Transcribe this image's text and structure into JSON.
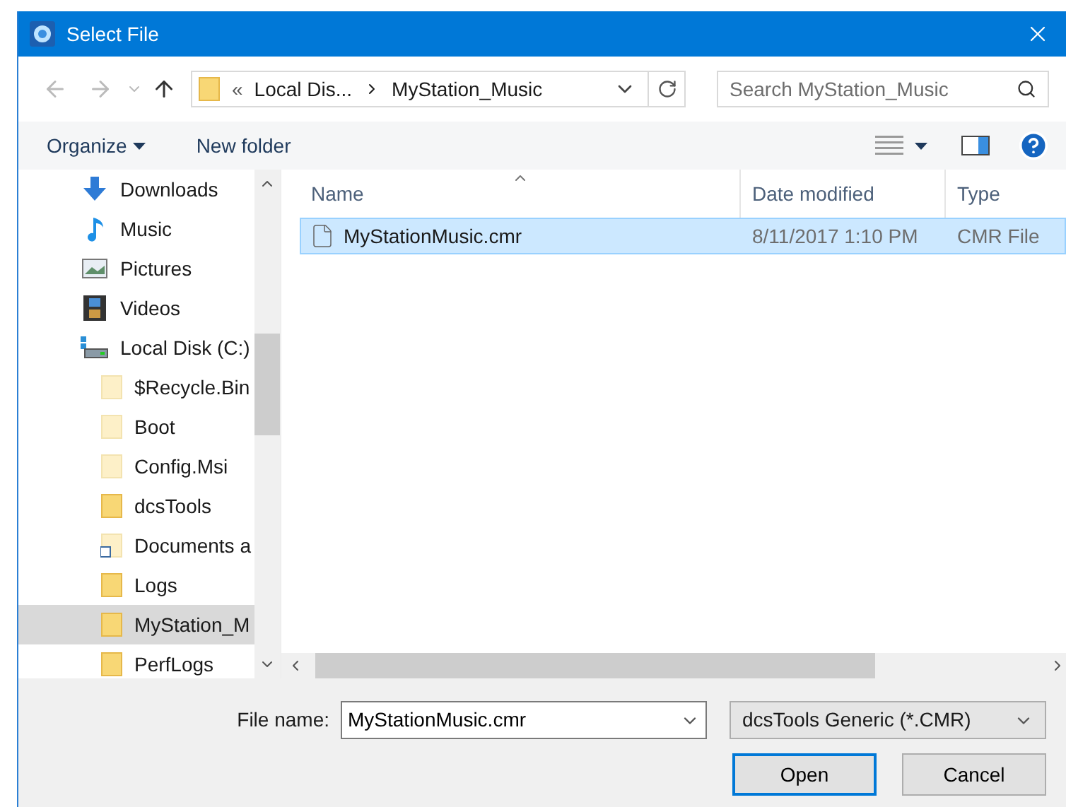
{
  "window": {
    "title": "Select File"
  },
  "address": {
    "overflow": "«",
    "crumbs": [
      "Local Dis...",
      "MyStation_Music"
    ]
  },
  "search": {
    "placeholder": "Search MyStation_Music"
  },
  "toolbar": {
    "organize": "Organize",
    "new_folder": "New folder"
  },
  "sidebar": {
    "items": [
      {
        "kind": "downloads",
        "label": "Downloads",
        "selected": false
      },
      {
        "kind": "music",
        "label": "Music",
        "selected": false
      },
      {
        "kind": "pictures",
        "label": "Pictures",
        "selected": false
      },
      {
        "kind": "videos",
        "label": "Videos",
        "selected": false
      },
      {
        "kind": "drive",
        "label": "Local Disk (C:)",
        "selected": false,
        "children": [
          {
            "kind": "folder",
            "label": "$Recycle.Bin",
            "hidden": true,
            "selected": false
          },
          {
            "kind": "folder",
            "label": "Boot",
            "hidden": true,
            "selected": false
          },
          {
            "kind": "folder",
            "label": "Config.Msi",
            "hidden": true,
            "selected": false
          },
          {
            "kind": "folder",
            "label": "dcsTools",
            "hidden": false,
            "selected": false
          },
          {
            "kind": "shortcut",
            "label": "Documents a",
            "hidden": true,
            "selected": false
          },
          {
            "kind": "folder",
            "label": "Logs",
            "hidden": false,
            "selected": false
          },
          {
            "kind": "folder",
            "label": "MyStation_M",
            "hidden": false,
            "selected": true
          },
          {
            "kind": "folder",
            "label": "PerfLogs",
            "hidden": false,
            "selected": false
          }
        ]
      }
    ]
  },
  "table": {
    "columns": [
      "Name",
      "Date modified",
      "Type"
    ],
    "rows": [
      {
        "name": "MyStationMusic.cmr",
        "date": "8/11/2017 1:10 PM",
        "type": "CMR File",
        "selected": true
      }
    ]
  },
  "file_name": {
    "label": "File name:",
    "value": "MyStationMusic.cmr"
  },
  "file_type": {
    "value": "dcsTools Generic (*.CMR)"
  },
  "buttons": [
    "Open",
    "Cancel"
  ]
}
